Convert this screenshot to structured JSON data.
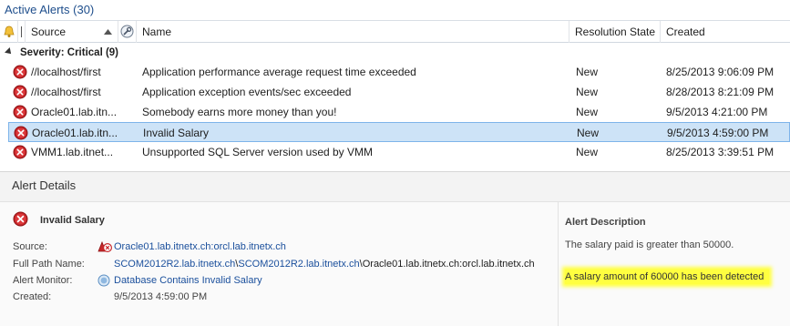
{
  "window": {
    "title": "Active Alerts (30)"
  },
  "columns": {
    "source": "Source",
    "name": "Name",
    "resolution_state": "Resolution State",
    "created": "Created"
  },
  "group": {
    "label": "Severity: Critical (9)"
  },
  "rows": [
    {
      "source": "//localhost/first",
      "name": "Application performance average request time exceeded",
      "state": "New",
      "created": "8/25/2013 9:06:09 PM"
    },
    {
      "source": "//localhost/first",
      "name": "Application exception events/sec exceeded",
      "state": "New",
      "created": "8/28/2013 8:21:09 PM"
    },
    {
      "source": "Oracle01.lab.itn...",
      "name": "Somebody earns more money than you!",
      "state": "New",
      "created": "9/5/2013 4:21:00 PM"
    },
    {
      "source": "Oracle01.lab.itn...",
      "name": "Invalid Salary",
      "state": "New",
      "created": "9/5/2013 4:59:00 PM"
    },
    {
      "source": "VMM1.lab.itnet...",
      "name": "Unsupported SQL Server version used by VMM",
      "state": "New",
      "created": "8/25/2013 3:39:51 PM"
    }
  ],
  "selected_row_index": 3,
  "details": {
    "title": "Alert Details",
    "alert_name": "Invalid Salary",
    "labels": {
      "source": "Source:",
      "full_path": "Full Path Name:",
      "monitor": "Alert Monitor:",
      "created": "Created:"
    },
    "source_link": "Oracle01.lab.itnetx.ch:orcl.lab.itnetx.ch",
    "full_path_links": [
      "SCOM2012R2.lab.itnetx.ch",
      "SCOM2012R2.lab.itnetx.ch",
      "Oracle01.lab.itnetx.ch:orcl.lab.itnetx.ch"
    ],
    "path_separator": "\\",
    "monitor_link": "Database Contains Invalid Salary",
    "created_value": "9/5/2013 4:59:00 PM",
    "description_title": "Alert Description",
    "description_line1": "The salary paid is greater than 50000.",
    "description_line2": "A salary amount of 60000 has been detected"
  },
  "colors": {
    "title": "#1e4e8c",
    "link": "#1a4f9c",
    "selection": "#cde3f7",
    "highlight": "#ffff40",
    "critical": "#c8282b"
  },
  "icons": [
    "alert-bell-icon",
    "sort-asc-icon",
    "maintenance-icon",
    "critical-error-icon",
    "monitor-healthy-icon",
    "source-error-icon"
  ]
}
